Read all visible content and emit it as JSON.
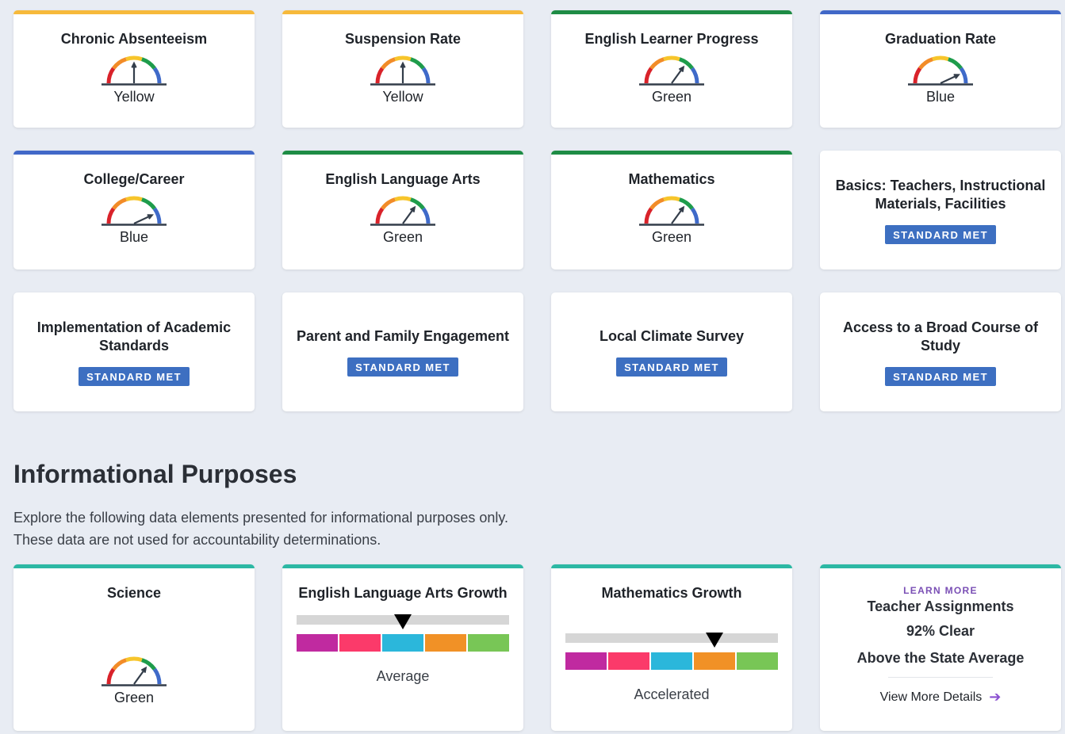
{
  "colors": {
    "yellow": "#f6b93b",
    "green": "#1e8c45",
    "blue": "#4168c8",
    "teal": "#2cb8a4",
    "badge": "#3d6fc1",
    "gauge_red": "#d9222a",
    "gauge_orange": "#f28c28",
    "gauge_yellow": "#f7c52b",
    "gauge_green": "#1e9c4b",
    "gauge_blue": "#3f6ac9",
    "needle": "#333d4a",
    "growth_scale": [
      "#c02aa0",
      "#fb3a6a",
      "#2bb7db",
      "#f19126",
      "#78c656"
    ]
  },
  "state_indicators": [
    {
      "title": "Chronic Absenteeism",
      "status": "Yellow",
      "color": "yellow",
      "needle_level": "yellow"
    },
    {
      "title": "Suspension Rate",
      "status": "Yellow",
      "color": "yellow",
      "needle_level": "yellow"
    },
    {
      "title": "English Learner Progress",
      "status": "Green",
      "color": "green",
      "needle_level": "green"
    },
    {
      "title": "Graduation Rate",
      "status": "Blue",
      "color": "blue",
      "needle_level": "blue"
    },
    {
      "title": "College/Career",
      "status": "Blue",
      "color": "blue",
      "needle_level": "blue"
    },
    {
      "title": "English Language Arts",
      "status": "Green",
      "color": "green",
      "needle_level": "green"
    },
    {
      "title": "Mathematics",
      "status": "Green",
      "color": "green",
      "needle_level": "green"
    }
  ],
  "local_indicators": [
    {
      "title": "Basics: Teachers, Instructional Materials, Facilities",
      "badge": "STANDARD MET"
    },
    {
      "title": "Implementation of Academic Standards",
      "badge": "STANDARD MET"
    },
    {
      "title": "Parent and Family Engagement",
      "badge": "STANDARD MET"
    },
    {
      "title": "Local Climate Survey",
      "badge": "STANDARD MET"
    },
    {
      "title": "Access to a Broad Course of Study",
      "badge": "STANDARD MET"
    }
  ],
  "informational": {
    "heading": "Informational Purposes",
    "description": "Explore the following data elements presented for informational purposes only. These data are not used for accountability determinations.",
    "science": {
      "title": "Science",
      "status": "Green",
      "needle_level": "green"
    },
    "ela_growth": {
      "title": "English Language Arts Growth",
      "label": "Average",
      "marker_fraction": 0.5
    },
    "math_growth": {
      "title": "Mathematics Growth",
      "label": "Accelerated",
      "marker_fraction": 0.7
    },
    "teacher_assignments": {
      "eyebrow": "LEARN MORE",
      "title": "Teacher Assignments",
      "value": "92% Clear",
      "comparison": "Above the State Average",
      "link": "View More Details",
      "link_icon": "arrow-right-icon"
    }
  }
}
